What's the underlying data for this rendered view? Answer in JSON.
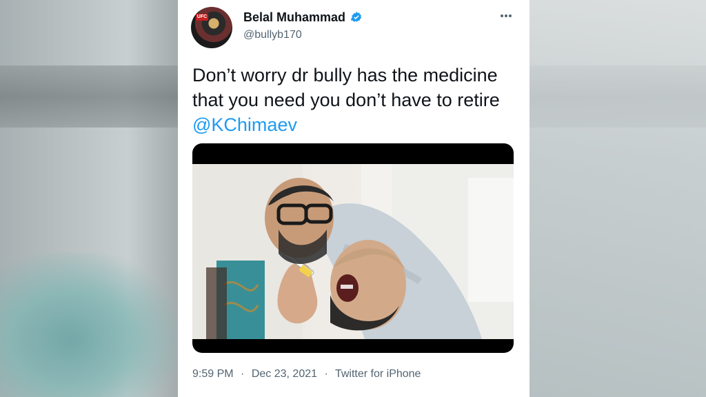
{
  "tweet": {
    "author_name": "Belal Muhammad",
    "author_handle": "@bullyb170",
    "text_prefix": "Don’t worry dr bully has the medicine that you need you don’t have to retire ",
    "mention": "@KChimaev",
    "meta": {
      "time": "9:59 PM",
      "separator_1": "·",
      "date": "Dec 23, 2021",
      "separator_2": "·",
      "client": "Twitter for iPhone"
    }
  },
  "icons": {
    "verified": "verified-badge-icon",
    "more": "more-options-icon"
  },
  "colors": {
    "text_primary": "#0f1419",
    "text_secondary": "#536471",
    "link": "#1d9bf0",
    "verified": "#1d9bf0"
  }
}
